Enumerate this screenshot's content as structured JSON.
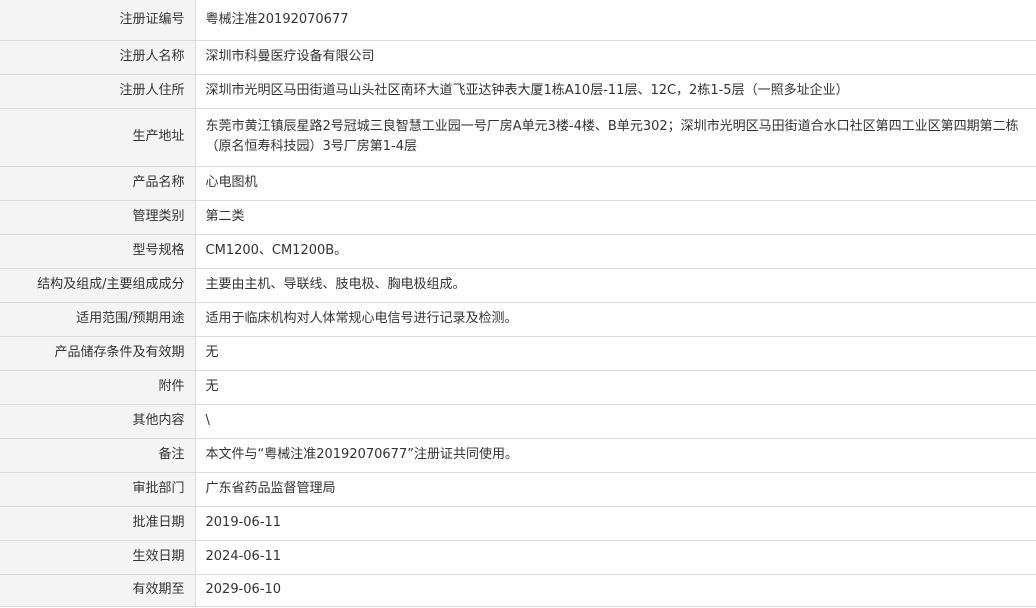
{
  "rows": [
    {
      "label": "注册证编号",
      "value": "粤械注准20192070677"
    },
    {
      "label": "注册人名称",
      "value": "深圳市科曼医疗设备有限公司"
    },
    {
      "label": "注册人住所",
      "value": "深圳市光明区马田街道马山头社区南环大道飞亚达钟表大厦1栋A10层-11层、12C，2栋1-5层（一照多址企业）"
    },
    {
      "label": "生产地址",
      "value": "东莞市黄江镇辰星路2号冠城三良智慧工业园一号厂房A单元3楼-4楼、B单元302；深圳市光明区马田街道合水口社区第四工业区第四期第二栋（原名恒寿科技园）3号厂房第1-4层"
    },
    {
      "label": "产品名称",
      "value": "心电图机"
    },
    {
      "label": "管理类别",
      "value": "第二类"
    },
    {
      "label": "型号规格",
      "value": "CM1200、CM1200B。"
    },
    {
      "label": "结构及组成/主要组成成分",
      "value": "主要由主机、导联线、肢电极、胸电极组成。"
    },
    {
      "label": "适用范围/预期用途",
      "value": "适用于临床机构对人体常规心电信号进行记录及检测。"
    },
    {
      "label": "产品储存条件及有效期",
      "value": "无"
    },
    {
      "label": "附件",
      "value": "无"
    },
    {
      "label": "其他内容",
      "value": "\\"
    },
    {
      "label": "备注",
      "value": "本文件与“粤械注准20192070677”注册证共同使用。"
    },
    {
      "label": "审批部门",
      "value": "广东省药品监督管理局"
    },
    {
      "label": "批准日期",
      "value": "2019-06-11"
    },
    {
      "label": "生效日期",
      "value": "2024-06-11"
    },
    {
      "label": "有效期至",
      "value": "2029-06-10"
    }
  ]
}
